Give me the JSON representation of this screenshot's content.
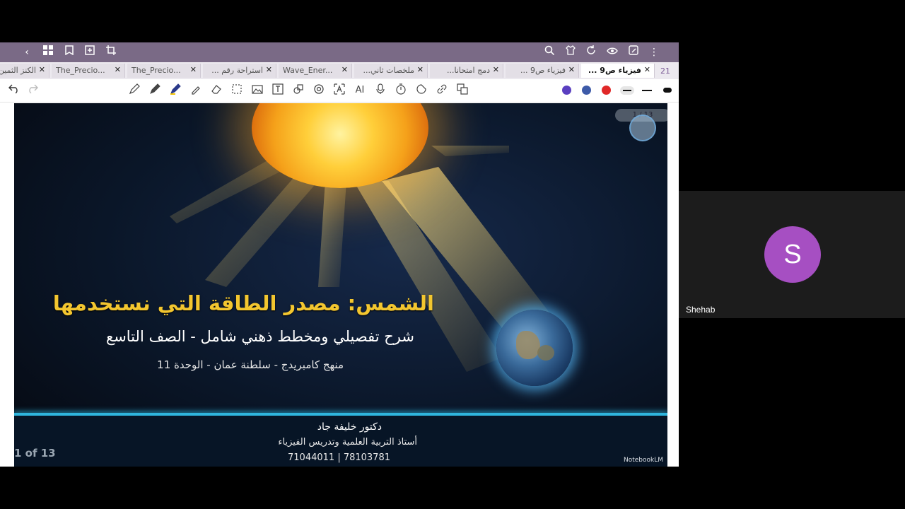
{
  "toolbar_top": {
    "left_icons": [
      "back-chevron-icon",
      "grid-icon",
      "bookmark-icon",
      "add-page-icon",
      "crop-icon"
    ],
    "right_icons": [
      "search-icon",
      "shirt-icon",
      "refresh-icon",
      "eye-icon",
      "edit-icon",
      "more-icon"
    ],
    "back_glyph": "‹",
    "more_glyph": "⋮"
  },
  "tabs": [
    {
      "label": "الكنز الثمين"
    },
    {
      "label": "The_Precio..."
    },
    {
      "label": "The_Precio..."
    },
    {
      "label": "استراحة رقم ..."
    },
    {
      "label": "Wave_Ener..."
    },
    {
      "label": "ملخصات ثاني..."
    },
    {
      "label": "دمج امتحانا..."
    },
    {
      "label": "فيزياء ص9 ..."
    },
    {
      "label": "فيزياء ص9 ..."
    }
  ],
  "tab_close": "✕",
  "tab_count": "21",
  "drawing_tools": [
    "undo-icon",
    "redo-icon",
    "pencil-icon",
    "pen-icon",
    "highlighter-icon",
    "marker-icon",
    "eraser-icon",
    "lasso-icon",
    "image-icon",
    "text-icon",
    "shapes-icon",
    "ocr-icon",
    "translate-icon",
    "ai-icon",
    "mic-icon",
    "timer-icon",
    "sticker-icon",
    "link-icon",
    "translate2-icon"
  ],
  "ai_label": "AI",
  "colors": [
    "#5a3fc0",
    "#3d5aa8",
    "#e02828"
  ],
  "slide": {
    "title": "الشمس: مصدر الطاقة التي نستخدمها",
    "subtitle": "شرح تفصيلي ومخطط ذهني شامل - الصف التاسع",
    "curriculum": "منهج كامبريدج - سلطنة عمان - الوحدة 11",
    "author": "دكتور خليفة جاد",
    "role": "أستاذ التربية العلمية وتدريس الفيزياء",
    "phones": "71044011 | 78103781",
    "page_indicator": "1 of 13",
    "pager": "1 / 13",
    "brand": "NotebookLM"
  },
  "participant": {
    "initial": "S",
    "name": "Shehab",
    "avatar_color": "#a64fc2"
  }
}
